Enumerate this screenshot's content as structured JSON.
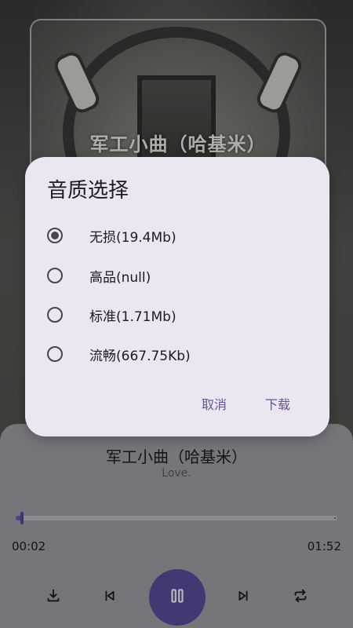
{
  "cover": {
    "title": "军工小曲（哈基米）"
  },
  "dialog": {
    "title": "音质选择",
    "options": [
      {
        "label": "无损(19.4Mb)",
        "selected": true
      },
      {
        "label": "高品(null)",
        "selected": false
      },
      {
        "label": "标准(1.71Mb)",
        "selected": false
      },
      {
        "label": "流畅(667.75Kb)",
        "selected": false
      }
    ],
    "cancel_label": "取消",
    "download_label": "下载"
  },
  "player": {
    "song_title": "军工小曲（哈基米）",
    "artist": "Love.",
    "current_time": "00:02",
    "total_time": "01:52",
    "progress": 0.02,
    "icons": [
      "download-icon",
      "skip-previous-icon",
      "pause-icon",
      "skip-next-icon",
      "repeat-icon"
    ]
  },
  "colors": {
    "accent": "#5f4e9e",
    "dialog_bg": "#ece6f0",
    "panel_bg": "#a6a2a9"
  }
}
